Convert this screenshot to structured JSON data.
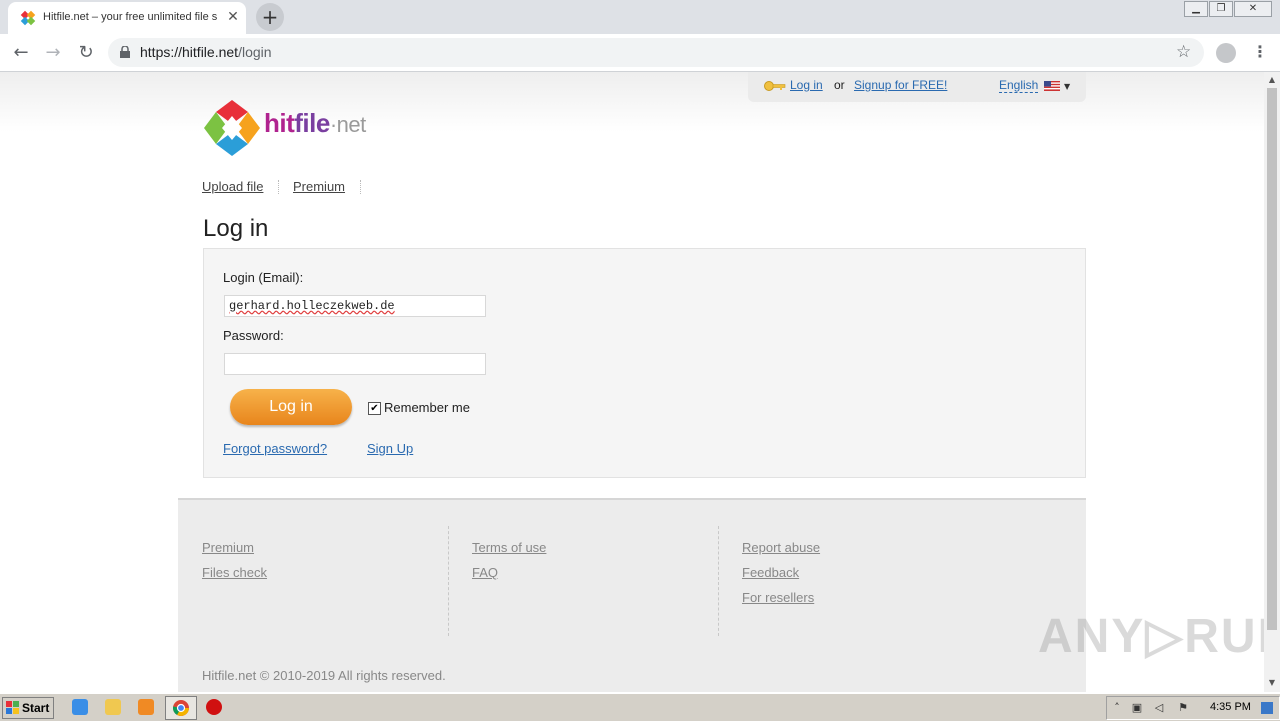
{
  "browser": {
    "tab_title": "Hitfile.net – your free unlimited file s",
    "new_tab_symbol": "+",
    "close_symbol": "✕",
    "url_host": "https://hitfile.net",
    "url_path": "/login"
  },
  "header": {
    "login_link": "Log in",
    "or_text": "or",
    "signup_link": "Signup for FREE!",
    "language": "English"
  },
  "logo": {
    "hit": "hit",
    "file": "file",
    "net": "·net"
  },
  "nav": {
    "upload": "Upload file",
    "premium": "Premium"
  },
  "login": {
    "title": "Log in",
    "email_label": "Login (Email):",
    "email_value": "gerhard.holleczekweb.de",
    "password_label": "Password:",
    "password_value": "",
    "button": "Log in",
    "remember_label": "Remember me",
    "remember_checked": true,
    "forgot": "Forgot password?",
    "signup": "Sign Up"
  },
  "footer": {
    "col1": [
      "Premium",
      "Files check"
    ],
    "col2": [
      "Terms of use",
      "FAQ"
    ],
    "col3": [
      "Report abuse",
      "Feedback",
      "For resellers"
    ],
    "copyright": "Hitfile.net © 2010-2019 All rights reserved."
  },
  "watermark": "ANY▷RUN",
  "taskbar": {
    "start": "Start",
    "clock": "4:35 PM"
  }
}
